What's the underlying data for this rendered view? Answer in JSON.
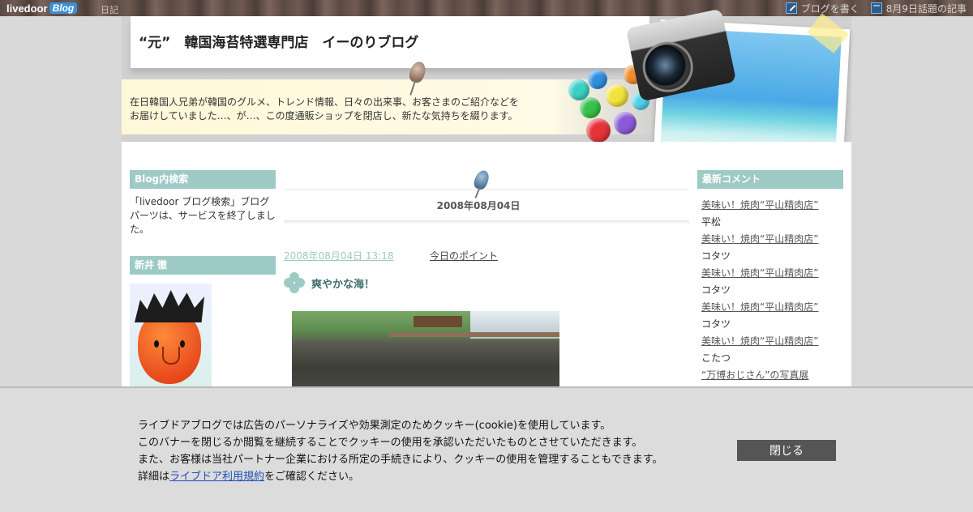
{
  "topbar": {
    "logo_main": "livedoor",
    "logo_blog": "Blog",
    "nav_diary": "日記",
    "write_blog": "ブログを書く",
    "trending": "8月9日話題の記事"
  },
  "header": {
    "blog_title": "“元”　韓国海苔特選専門店　イーのりブログ",
    "description": "在日韓国人兄弟が韓国のグルメ、トレンド情報、日々の出来事、お客さまのご紹介などをお届けしていました…、が…、この度通販ショップを閉店し、新たな気持ちを綴ります。"
  },
  "left_sidebar": {
    "search_heading": "Blog内検索",
    "search_notice": "「livedoor ブログ検索」ブログパーツは、サービスを終了しました。",
    "profile_heading": "新井 徹"
  },
  "entry": {
    "date_heading": "2008年08月04日",
    "timestamp": "2008年08月04日 13:18",
    "category": "今日のポイント",
    "title": "爽やかな海！"
  },
  "right_sidebar": {
    "comments_heading": "最新コメント",
    "comments": [
      {
        "link": "美味い！焼肉“平山精肉店”",
        "author": "平松"
      },
      {
        "link": "美味い！焼肉“平山精肉店”",
        "author": "コタツ"
      },
      {
        "link": "美味い！焼肉“平山精肉店”",
        "author": "コタツ"
      },
      {
        "link": "美味い！焼肉“平山精肉店”",
        "author": "コタツ"
      },
      {
        "link": "美味い！焼肉“平山精肉店”",
        "author": "こたつ"
      },
      {
        "link": "“万博おじさん”の写真展",
        "author": ""
      }
    ]
  },
  "cookie_banner": {
    "line1": "ライブドアブログでは広告のパーソナライズや効果測定のためクッキー(cookie)を使用しています。",
    "line2": "このバナーを閉じるか閲覧を継続することでクッキーの使用を承認いただいたものとさせていただきます。",
    "line3": "また、お客様は当社パートナー企業における所定の手続きにより、クッキーの使用を管理することもできます。",
    "line4_prefix": "詳細は",
    "terms_link": "ライブドア利用規約",
    "line4_suffix": "をご確認ください。",
    "close_label": "閉じる"
  },
  "colors": {
    "accent_teal": "#9ecac5",
    "page_background": "#d9d9d9",
    "close_button": "#555555"
  }
}
